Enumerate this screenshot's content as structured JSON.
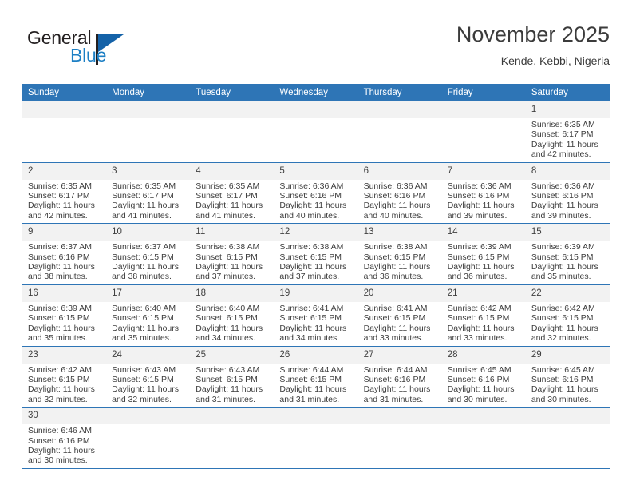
{
  "brand": {
    "word_one": "General",
    "word_two": "Blue",
    "logo_icon": "triangle-flag-icon"
  },
  "header": {
    "month_title": "November 2025",
    "location": "Kende, Kebbi, Nigeria"
  },
  "calendar": {
    "weekday_headers": [
      "Sunday",
      "Monday",
      "Tuesday",
      "Wednesday",
      "Thursday",
      "Friday",
      "Saturday"
    ],
    "labels": {
      "sunrise_prefix": "Sunrise:",
      "sunset_prefix": "Sunset:",
      "daylight_prefix": "Daylight:"
    },
    "weeks": [
      [
        {
          "day": "",
          "empty": true
        },
        {
          "day": "",
          "empty": true
        },
        {
          "day": "",
          "empty": true
        },
        {
          "day": "",
          "empty": true
        },
        {
          "day": "",
          "empty": true
        },
        {
          "day": "",
          "empty": true
        },
        {
          "day": "1",
          "sunrise": "Sunrise: 6:35 AM",
          "sunset": "Sunset: 6:17 PM",
          "daylight": "Daylight: 11 hours and 42 minutes."
        }
      ],
      [
        {
          "day": "2",
          "sunrise": "Sunrise: 6:35 AM",
          "sunset": "Sunset: 6:17 PM",
          "daylight": "Daylight: 11 hours and 42 minutes."
        },
        {
          "day": "3",
          "sunrise": "Sunrise: 6:35 AM",
          "sunset": "Sunset: 6:17 PM",
          "daylight": "Daylight: 11 hours and 41 minutes."
        },
        {
          "day": "4",
          "sunrise": "Sunrise: 6:35 AM",
          "sunset": "Sunset: 6:17 PM",
          "daylight": "Daylight: 11 hours and 41 minutes."
        },
        {
          "day": "5",
          "sunrise": "Sunrise: 6:36 AM",
          "sunset": "Sunset: 6:16 PM",
          "daylight": "Daylight: 11 hours and 40 minutes."
        },
        {
          "day": "6",
          "sunrise": "Sunrise: 6:36 AM",
          "sunset": "Sunset: 6:16 PM",
          "daylight": "Daylight: 11 hours and 40 minutes."
        },
        {
          "day": "7",
          "sunrise": "Sunrise: 6:36 AM",
          "sunset": "Sunset: 6:16 PM",
          "daylight": "Daylight: 11 hours and 39 minutes."
        },
        {
          "day": "8",
          "sunrise": "Sunrise: 6:36 AM",
          "sunset": "Sunset: 6:16 PM",
          "daylight": "Daylight: 11 hours and 39 minutes."
        }
      ],
      [
        {
          "day": "9",
          "sunrise": "Sunrise: 6:37 AM",
          "sunset": "Sunset: 6:16 PM",
          "daylight": "Daylight: 11 hours and 38 minutes."
        },
        {
          "day": "10",
          "sunrise": "Sunrise: 6:37 AM",
          "sunset": "Sunset: 6:15 PM",
          "daylight": "Daylight: 11 hours and 38 minutes."
        },
        {
          "day": "11",
          "sunrise": "Sunrise: 6:38 AM",
          "sunset": "Sunset: 6:15 PM",
          "daylight": "Daylight: 11 hours and 37 minutes."
        },
        {
          "day": "12",
          "sunrise": "Sunrise: 6:38 AM",
          "sunset": "Sunset: 6:15 PM",
          "daylight": "Daylight: 11 hours and 37 minutes."
        },
        {
          "day": "13",
          "sunrise": "Sunrise: 6:38 AM",
          "sunset": "Sunset: 6:15 PM",
          "daylight": "Daylight: 11 hours and 36 minutes."
        },
        {
          "day": "14",
          "sunrise": "Sunrise: 6:39 AM",
          "sunset": "Sunset: 6:15 PM",
          "daylight": "Daylight: 11 hours and 36 minutes."
        },
        {
          "day": "15",
          "sunrise": "Sunrise: 6:39 AM",
          "sunset": "Sunset: 6:15 PM",
          "daylight": "Daylight: 11 hours and 35 minutes."
        }
      ],
      [
        {
          "day": "16",
          "sunrise": "Sunrise: 6:39 AM",
          "sunset": "Sunset: 6:15 PM",
          "daylight": "Daylight: 11 hours and 35 minutes."
        },
        {
          "day": "17",
          "sunrise": "Sunrise: 6:40 AM",
          "sunset": "Sunset: 6:15 PM",
          "daylight": "Daylight: 11 hours and 35 minutes."
        },
        {
          "day": "18",
          "sunrise": "Sunrise: 6:40 AM",
          "sunset": "Sunset: 6:15 PM",
          "daylight": "Daylight: 11 hours and 34 minutes."
        },
        {
          "day": "19",
          "sunrise": "Sunrise: 6:41 AM",
          "sunset": "Sunset: 6:15 PM",
          "daylight": "Daylight: 11 hours and 34 minutes."
        },
        {
          "day": "20",
          "sunrise": "Sunrise: 6:41 AM",
          "sunset": "Sunset: 6:15 PM",
          "daylight": "Daylight: 11 hours and 33 minutes."
        },
        {
          "day": "21",
          "sunrise": "Sunrise: 6:42 AM",
          "sunset": "Sunset: 6:15 PM",
          "daylight": "Daylight: 11 hours and 33 minutes."
        },
        {
          "day": "22",
          "sunrise": "Sunrise: 6:42 AM",
          "sunset": "Sunset: 6:15 PM",
          "daylight": "Daylight: 11 hours and 32 minutes."
        }
      ],
      [
        {
          "day": "23",
          "sunrise": "Sunrise: 6:42 AM",
          "sunset": "Sunset: 6:15 PM",
          "daylight": "Daylight: 11 hours and 32 minutes."
        },
        {
          "day": "24",
          "sunrise": "Sunrise: 6:43 AM",
          "sunset": "Sunset: 6:15 PM",
          "daylight": "Daylight: 11 hours and 32 minutes."
        },
        {
          "day": "25",
          "sunrise": "Sunrise: 6:43 AM",
          "sunset": "Sunset: 6:15 PM",
          "daylight": "Daylight: 11 hours and 31 minutes."
        },
        {
          "day": "26",
          "sunrise": "Sunrise: 6:44 AM",
          "sunset": "Sunset: 6:15 PM",
          "daylight": "Daylight: 11 hours and 31 minutes."
        },
        {
          "day": "27",
          "sunrise": "Sunrise: 6:44 AM",
          "sunset": "Sunset: 6:16 PM",
          "daylight": "Daylight: 11 hours and 31 minutes."
        },
        {
          "day": "28",
          "sunrise": "Sunrise: 6:45 AM",
          "sunset": "Sunset: 6:16 PM",
          "daylight": "Daylight: 11 hours and 30 minutes."
        },
        {
          "day": "29",
          "sunrise": "Sunrise: 6:45 AM",
          "sunset": "Sunset: 6:16 PM",
          "daylight": "Daylight: 11 hours and 30 minutes."
        }
      ],
      [
        {
          "day": "30",
          "sunrise": "Sunrise: 6:46 AM",
          "sunset": "Sunset: 6:16 PM",
          "daylight": "Daylight: 11 hours and 30 minutes."
        },
        {
          "day": "",
          "empty": true
        },
        {
          "day": "",
          "empty": true
        },
        {
          "day": "",
          "empty": true
        },
        {
          "day": "",
          "empty": true
        },
        {
          "day": "",
          "empty": true
        },
        {
          "day": "",
          "empty": true
        }
      ]
    ]
  },
  "colors": {
    "header_blue": "#2e75b6",
    "brand_blue": "#1c7fc4",
    "daynum_gray": "#f2f2f2",
    "text": "#3d3d3d"
  }
}
